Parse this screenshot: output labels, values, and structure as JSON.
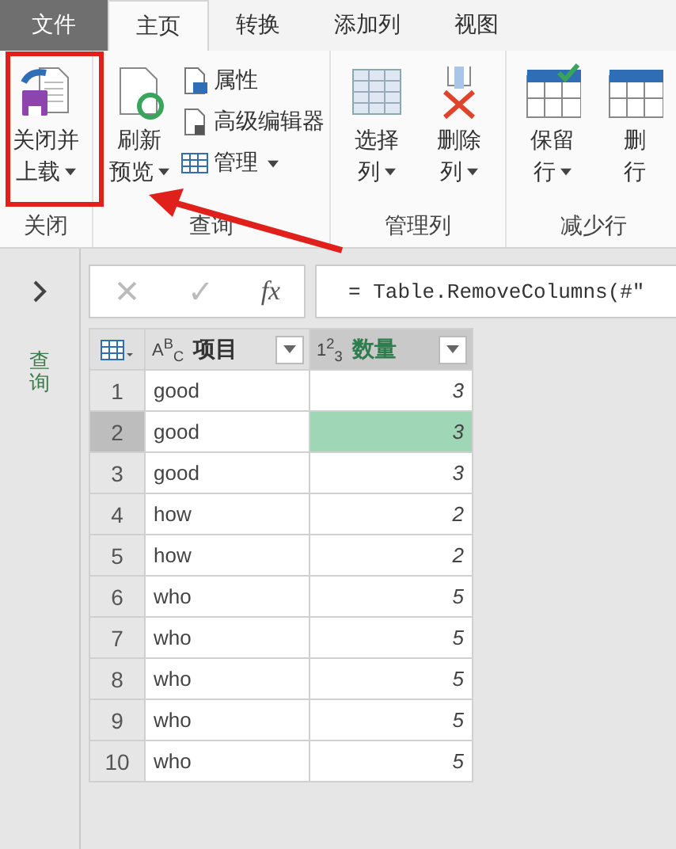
{
  "tabs": [
    {
      "label": "文件",
      "kind": "file",
      "selected": false
    },
    {
      "label": "主页",
      "kind": "tab",
      "selected": true
    },
    {
      "label": "转换",
      "kind": "tab",
      "selected": false
    },
    {
      "label": "添加列",
      "kind": "tab",
      "selected": false
    },
    {
      "label": "视图",
      "kind": "tab",
      "selected": false
    }
  ],
  "ribbon": [
    {
      "label": "关闭",
      "large": [
        {
          "lines": [
            "关闭并",
            "上载"
          ],
          "dropdown": true
        }
      ]
    },
    {
      "label": "查询",
      "large": [
        {
          "lines": [
            "刷新",
            "预览"
          ],
          "dropdown": true
        }
      ],
      "small": [
        {
          "label": "属性",
          "dropdown": false
        },
        {
          "label": "高级编辑器",
          "dropdown": false
        },
        {
          "label": "管理",
          "dropdown": true
        }
      ]
    },
    {
      "label": "管理列",
      "large": [
        {
          "lines": [
            "选择",
            "列"
          ],
          "dropdown": true
        },
        {
          "lines": [
            "删除",
            "列"
          ],
          "dropdown": true
        }
      ]
    },
    {
      "label": "减少行",
      "large": [
        {
          "lines": [
            "保留",
            "行"
          ],
          "dropdown": true
        },
        {
          "lines": [
            "删",
            "行"
          ],
          "dropdown": false
        }
      ]
    }
  ],
  "sidebar": {
    "label": "查询"
  },
  "formula": {
    "cancel": "✕",
    "confirm": "✓",
    "fx": "fx",
    "text": "= Table.RemoveColumns(#\""
  },
  "table": {
    "columns": [
      {
        "type": "A$^{B}$$_{C}$",
        "label": "项目",
        "kind": "text"
      },
      {
        "type": "1$^{2}$$_{3}$",
        "label": "数量",
        "kind": "number"
      }
    ],
    "rows": [
      {
        "index": "1",
        "cells": [
          "good",
          "3"
        ],
        "selected": false
      },
      {
        "index": "2",
        "cells": [
          "good",
          "3"
        ],
        "selected": true
      },
      {
        "index": "3",
        "cells": [
          "good",
          "3"
        ],
        "selected": false
      },
      {
        "index": "4",
        "cells": [
          "how",
          "2"
        ],
        "selected": false
      },
      {
        "index": "5",
        "cells": [
          "how",
          "2"
        ],
        "selected": false
      },
      {
        "index": "6",
        "cells": [
          "who",
          "5"
        ],
        "selected": false
      },
      {
        "index": "7",
        "cells": [
          "who",
          "5"
        ],
        "selected": false
      },
      {
        "index": "8",
        "cells": [
          "who",
          "5"
        ],
        "selected": false
      },
      {
        "index": "9",
        "cells": [
          "who",
          "5"
        ],
        "selected": false
      },
      {
        "index": "10",
        "cells": [
          "who",
          "5"
        ],
        "selected": false
      }
    ]
  }
}
